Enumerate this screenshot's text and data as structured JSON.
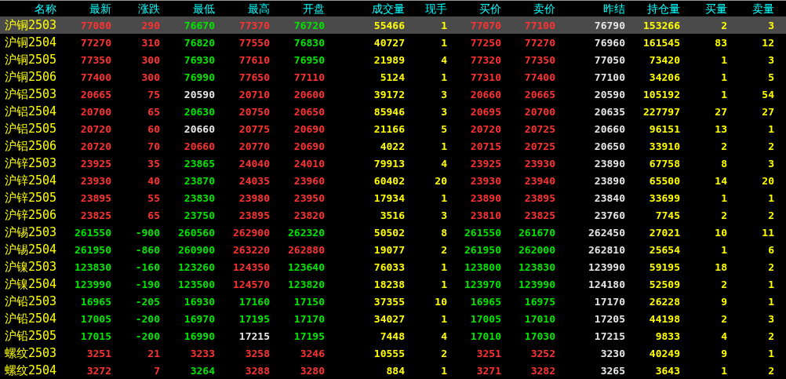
{
  "table": {
    "columns": [
      "名称",
      "最新",
      "涨跌",
      "最低",
      "最高",
      "开盘",
      "成交量",
      "现手",
      "买价",
      "卖价",
      "昨结",
      "持仓量",
      "买量",
      "卖量"
    ],
    "rows": [
      {
        "selected": true,
        "cells": [
          "沪铜2503",
          {
            "text": "77080",
            "color": "#ff3232"
          },
          {
            "text": "290",
            "color": "#ff3232"
          },
          {
            "text": "76670",
            "color": "#00e600"
          },
          {
            "text": "77370",
            "color": "#ff3232"
          },
          {
            "text": "76720",
            "color": "#00e600"
          },
          "55466",
          "1",
          {
            "text": "77070",
            "color": "#ff3232"
          },
          {
            "text": "77100",
            "color": "#ff3232"
          },
          "76790",
          "153266",
          "2",
          "3"
        ]
      },
      {
        "selected": false,
        "cells": [
          "沪铜2504",
          {
            "text": "77270",
            "color": "#ff3232"
          },
          {
            "text": "310",
            "color": "#ff3232"
          },
          {
            "text": "76820",
            "color": "#00e600"
          },
          {
            "text": "77550",
            "color": "#ff3232"
          },
          {
            "text": "76830",
            "color": "#00e600"
          },
          "40727",
          "1",
          {
            "text": "77250",
            "color": "#ff3232"
          },
          {
            "text": "77270",
            "color": "#ff3232"
          },
          "76960",
          "161545",
          "83",
          "12"
        ]
      },
      {
        "selected": false,
        "cells": [
          "沪铜2505",
          {
            "text": "77350",
            "color": "#ff3232"
          },
          {
            "text": "300",
            "color": "#ff3232"
          },
          {
            "text": "76930",
            "color": "#00e600"
          },
          {
            "text": "77610",
            "color": "#ff3232"
          },
          {
            "text": "76950",
            "color": "#00e600"
          },
          "21989",
          "4",
          {
            "text": "77320",
            "color": "#ff3232"
          },
          {
            "text": "77350",
            "color": "#ff3232"
          },
          "77050",
          "73420",
          "1",
          "3"
        ]
      },
      {
        "selected": false,
        "cells": [
          "沪铜2506",
          {
            "text": "77400",
            "color": "#ff3232"
          },
          {
            "text": "300",
            "color": "#ff3232"
          },
          {
            "text": "76990",
            "color": "#00e600"
          },
          {
            "text": "77650",
            "color": "#ff3232"
          },
          {
            "text": "77110",
            "color": "#ff3232"
          },
          "5124",
          "1",
          {
            "text": "77310",
            "color": "#ff3232"
          },
          {
            "text": "77400",
            "color": "#ff3232"
          },
          "77100",
          "34206",
          "1",
          "5"
        ]
      },
      {
        "selected": false,
        "cells": [
          "沪铝2503",
          {
            "text": "20665",
            "color": "#ff3232"
          },
          {
            "text": "75",
            "color": "#ff3232"
          },
          {
            "text": "20590",
            "color": "#e6e6e6"
          },
          {
            "text": "20710",
            "color": "#ff3232"
          },
          {
            "text": "20600",
            "color": "#ff3232"
          },
          "39172",
          "3",
          {
            "text": "20660",
            "color": "#ff3232"
          },
          {
            "text": "20665",
            "color": "#ff3232"
          },
          "20590",
          "105192",
          "1",
          "54"
        ]
      },
      {
        "selected": false,
        "cells": [
          "沪铝2504",
          {
            "text": "20700",
            "color": "#ff3232"
          },
          {
            "text": "65",
            "color": "#ff3232"
          },
          {
            "text": "20630",
            "color": "#00e600"
          },
          {
            "text": "20750",
            "color": "#ff3232"
          },
          {
            "text": "20650",
            "color": "#ff3232"
          },
          "85946",
          "3",
          {
            "text": "20695",
            "color": "#ff3232"
          },
          {
            "text": "20700",
            "color": "#ff3232"
          },
          "20635",
          "227797",
          "27",
          "27"
        ]
      },
      {
        "selected": false,
        "cells": [
          "沪铝2505",
          {
            "text": "20720",
            "color": "#ff3232"
          },
          {
            "text": "60",
            "color": "#ff3232"
          },
          {
            "text": "20660",
            "color": "#e6e6e6"
          },
          {
            "text": "20775",
            "color": "#ff3232"
          },
          {
            "text": "20690",
            "color": "#ff3232"
          },
          "21166",
          "5",
          {
            "text": "20720",
            "color": "#ff3232"
          },
          {
            "text": "20725",
            "color": "#ff3232"
          },
          "20660",
          "96151",
          "13",
          "1"
        ]
      },
      {
        "selected": false,
        "cells": [
          "沪铝2506",
          {
            "text": "20720",
            "color": "#ff3232"
          },
          {
            "text": "70",
            "color": "#ff3232"
          },
          {
            "text": "20660",
            "color": "#ff3232"
          },
          {
            "text": "20770",
            "color": "#ff3232"
          },
          {
            "text": "20690",
            "color": "#ff3232"
          },
          "4022",
          "1",
          {
            "text": "20715",
            "color": "#ff3232"
          },
          {
            "text": "20725",
            "color": "#ff3232"
          },
          "20650",
          "33910",
          "2",
          "2"
        ]
      },
      {
        "selected": false,
        "cells": [
          "沪锌2503",
          {
            "text": "23925",
            "color": "#ff3232"
          },
          {
            "text": "35",
            "color": "#ff3232"
          },
          {
            "text": "23865",
            "color": "#00e600"
          },
          {
            "text": "24040",
            "color": "#ff3232"
          },
          {
            "text": "24010",
            "color": "#ff3232"
          },
          "79913",
          "4",
          {
            "text": "23925",
            "color": "#ff3232"
          },
          {
            "text": "23930",
            "color": "#ff3232"
          },
          "23890",
          "67758",
          "8",
          "3"
        ]
      },
      {
        "selected": false,
        "cells": [
          "沪锌2504",
          {
            "text": "23930",
            "color": "#ff3232"
          },
          {
            "text": "40",
            "color": "#ff3232"
          },
          {
            "text": "23870",
            "color": "#00e600"
          },
          {
            "text": "24035",
            "color": "#ff3232"
          },
          {
            "text": "23960",
            "color": "#ff3232"
          },
          "60402",
          "20",
          {
            "text": "23930",
            "color": "#ff3232"
          },
          {
            "text": "23940",
            "color": "#ff3232"
          },
          "23890",
          "65500",
          "14",
          "20"
        ]
      },
      {
        "selected": false,
        "cells": [
          "沪锌2505",
          {
            "text": "23895",
            "color": "#ff3232"
          },
          {
            "text": "55",
            "color": "#ff3232"
          },
          {
            "text": "23830",
            "color": "#00e600"
          },
          {
            "text": "23980",
            "color": "#ff3232"
          },
          {
            "text": "23950",
            "color": "#ff3232"
          },
          "17934",
          "1",
          {
            "text": "23890",
            "color": "#ff3232"
          },
          {
            "text": "23895",
            "color": "#ff3232"
          },
          "23840",
          "33699",
          "1",
          "1"
        ]
      },
      {
        "selected": false,
        "cells": [
          "沪锌2506",
          {
            "text": "23825",
            "color": "#ff3232"
          },
          {
            "text": "65",
            "color": "#ff3232"
          },
          {
            "text": "23750",
            "color": "#00e600"
          },
          {
            "text": "23895",
            "color": "#ff3232"
          },
          {
            "text": "23820",
            "color": "#ff3232"
          },
          "3516",
          "3",
          {
            "text": "23810",
            "color": "#ff3232"
          },
          {
            "text": "23825",
            "color": "#ff3232"
          },
          "23760",
          "7745",
          "2",
          "2"
        ]
      },
      {
        "selected": false,
        "cells": [
          "沪锡2503",
          {
            "text": "261550",
            "color": "#00e600"
          },
          {
            "text": "-900",
            "color": "#00e600"
          },
          {
            "text": "260560",
            "color": "#00e600"
          },
          {
            "text": "262900",
            "color": "#ff3232"
          },
          {
            "text": "262320",
            "color": "#00e600"
          },
          "50502",
          "8",
          {
            "text": "261550",
            "color": "#00e600"
          },
          {
            "text": "261670",
            "color": "#00e600"
          },
          "262450",
          "27021",
          "10",
          "11"
        ]
      },
      {
        "selected": false,
        "cells": [
          "沪锡2504",
          {
            "text": "261950",
            "color": "#00e600"
          },
          {
            "text": "-860",
            "color": "#00e600"
          },
          {
            "text": "260900",
            "color": "#00e600"
          },
          {
            "text": "263220",
            "color": "#ff3232"
          },
          {
            "text": "262880",
            "color": "#ff3232"
          },
          "19077",
          "2",
          {
            "text": "261950",
            "color": "#00e600"
          },
          {
            "text": "262000",
            "color": "#00e600"
          },
          "262810",
          "25654",
          "1",
          "6"
        ]
      },
      {
        "selected": false,
        "cells": [
          "沪镍2503",
          {
            "text": "123830",
            "color": "#00e600"
          },
          {
            "text": "-160",
            "color": "#00e600"
          },
          {
            "text": "123260",
            "color": "#00e600"
          },
          {
            "text": "124350",
            "color": "#ff3232"
          },
          {
            "text": "123640",
            "color": "#00e600"
          },
          "76033",
          "1",
          {
            "text": "123800",
            "color": "#00e600"
          },
          {
            "text": "123830",
            "color": "#00e600"
          },
          "123990",
          "59195",
          "18",
          "2"
        ]
      },
      {
        "selected": false,
        "cells": [
          "沪镍2504",
          {
            "text": "123990",
            "color": "#00e600"
          },
          {
            "text": "-190",
            "color": "#00e600"
          },
          {
            "text": "123500",
            "color": "#00e600"
          },
          {
            "text": "124570",
            "color": "#ff3232"
          },
          {
            "text": "123820",
            "color": "#00e600"
          },
          "18238",
          "1",
          {
            "text": "123970",
            "color": "#00e600"
          },
          {
            "text": "123990",
            "color": "#00e600"
          },
          "124180",
          "52509",
          "2",
          "1"
        ]
      },
      {
        "selected": false,
        "cells": [
          "沪铅2503",
          {
            "text": "16965",
            "color": "#00e600"
          },
          {
            "text": "-205",
            "color": "#00e600"
          },
          {
            "text": "16930",
            "color": "#00e600"
          },
          {
            "text": "17160",
            "color": "#00e600"
          },
          {
            "text": "17150",
            "color": "#00e600"
          },
          "37355",
          "10",
          {
            "text": "16965",
            "color": "#00e600"
          },
          {
            "text": "16975",
            "color": "#00e600"
          },
          "17170",
          "26228",
          "9",
          "1"
        ]
      },
      {
        "selected": false,
        "cells": [
          "沪铅2504",
          {
            "text": "17005",
            "color": "#00e600"
          },
          {
            "text": "-200",
            "color": "#00e600"
          },
          {
            "text": "16970",
            "color": "#00e600"
          },
          {
            "text": "17195",
            "color": "#00e600"
          },
          {
            "text": "17170",
            "color": "#00e600"
          },
          "34027",
          "1",
          {
            "text": "17005",
            "color": "#00e600"
          },
          {
            "text": "17010",
            "color": "#00e600"
          },
          "17205",
          "44198",
          "2",
          "3"
        ]
      },
      {
        "selected": false,
        "cells": [
          "沪铅2505",
          {
            "text": "17015",
            "color": "#00e600"
          },
          {
            "text": "-200",
            "color": "#00e600"
          },
          {
            "text": "16990",
            "color": "#00e600"
          },
          {
            "text": "17215",
            "color": "#e6e6e6"
          },
          {
            "text": "17195",
            "color": "#00e600"
          },
          "7448",
          "4",
          {
            "text": "17010",
            "color": "#00e600"
          },
          {
            "text": "17030",
            "color": "#00e600"
          },
          "17215",
          "9833",
          "4",
          "2"
        ]
      },
      {
        "selected": false,
        "cells": [
          "螺纹2503",
          {
            "text": "3251",
            "color": "#ff3232"
          },
          {
            "text": "21",
            "color": "#ff3232"
          },
          {
            "text": "3233",
            "color": "#ff3232"
          },
          {
            "text": "3258",
            "color": "#ff3232"
          },
          {
            "text": "3246",
            "color": "#ff3232"
          },
          "10555",
          "2",
          {
            "text": "3251",
            "color": "#ff3232"
          },
          {
            "text": "3252",
            "color": "#ff3232"
          },
          "3230",
          "40249",
          "9",
          "1"
        ]
      },
      {
        "selected": false,
        "cells": [
          "螺纹2504",
          {
            "text": "3272",
            "color": "#ff3232"
          },
          {
            "text": "7",
            "color": "#ff3232"
          },
          {
            "text": "3264",
            "color": "#00e600"
          },
          {
            "text": "3288",
            "color": "#ff3232"
          },
          {
            "text": "3280",
            "color": "#ff3232"
          },
          "884",
          "1",
          {
            "text": "3271",
            "color": "#ff3232"
          },
          {
            "text": "3282",
            "color": "#ff3232"
          },
          "3265",
          "3643",
          "1",
          "2"
        ]
      }
    ]
  }
}
